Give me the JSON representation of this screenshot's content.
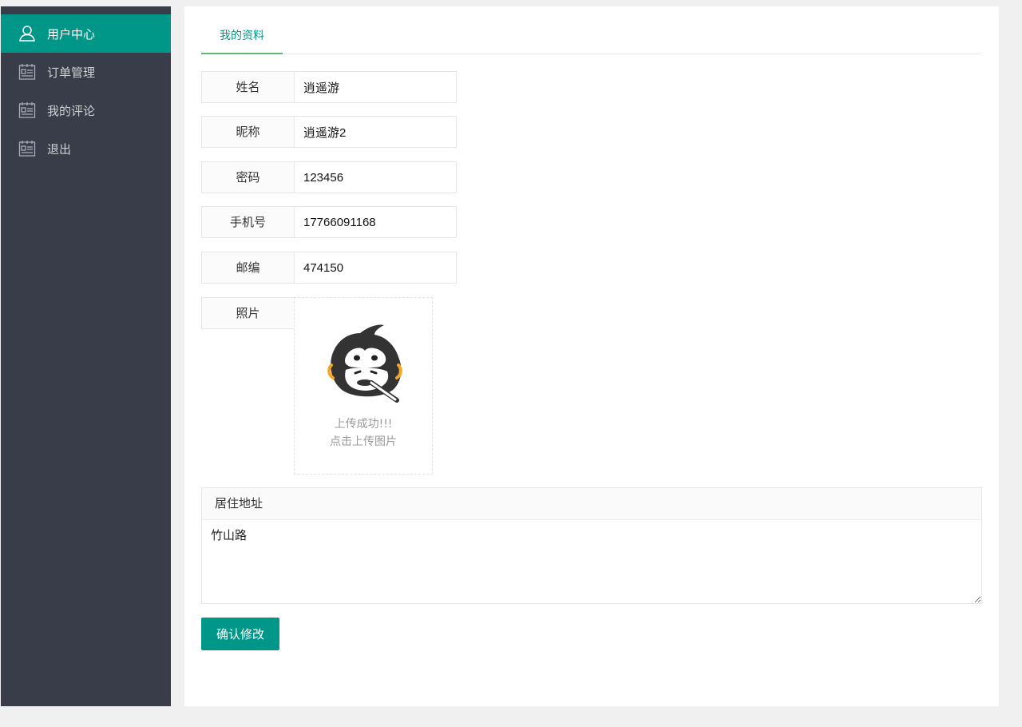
{
  "sidebar": {
    "items": [
      {
        "label": "用户中心",
        "icon": "user-icon",
        "active": true
      },
      {
        "label": "订单管理",
        "icon": "calendar-icon"
      },
      {
        "label": "我的评论",
        "icon": "calendar-icon"
      },
      {
        "label": "退出",
        "icon": "calendar-icon"
      }
    ]
  },
  "tabs": {
    "profile_label": "我的资料"
  },
  "form": {
    "name": {
      "label": "姓名",
      "value": "逍遥游"
    },
    "nickname": {
      "label": "昵称",
      "value": "逍遥游2"
    },
    "password": {
      "label": "密码",
      "value": "123456"
    },
    "phone": {
      "label": "手机号",
      "value": "17766091168"
    },
    "zipcode": {
      "label": "邮编",
      "value": "474150"
    },
    "photo": {
      "label": "照片",
      "status": "上传成功!!!",
      "hint": "点击上传图片"
    },
    "address": {
      "label": "居住地址",
      "value": "竹山路"
    },
    "submit_label": "确认修改"
  },
  "colors": {
    "accent": "#009688",
    "sidebar_bg": "#393d49",
    "tab_underline": "#5FB878"
  }
}
